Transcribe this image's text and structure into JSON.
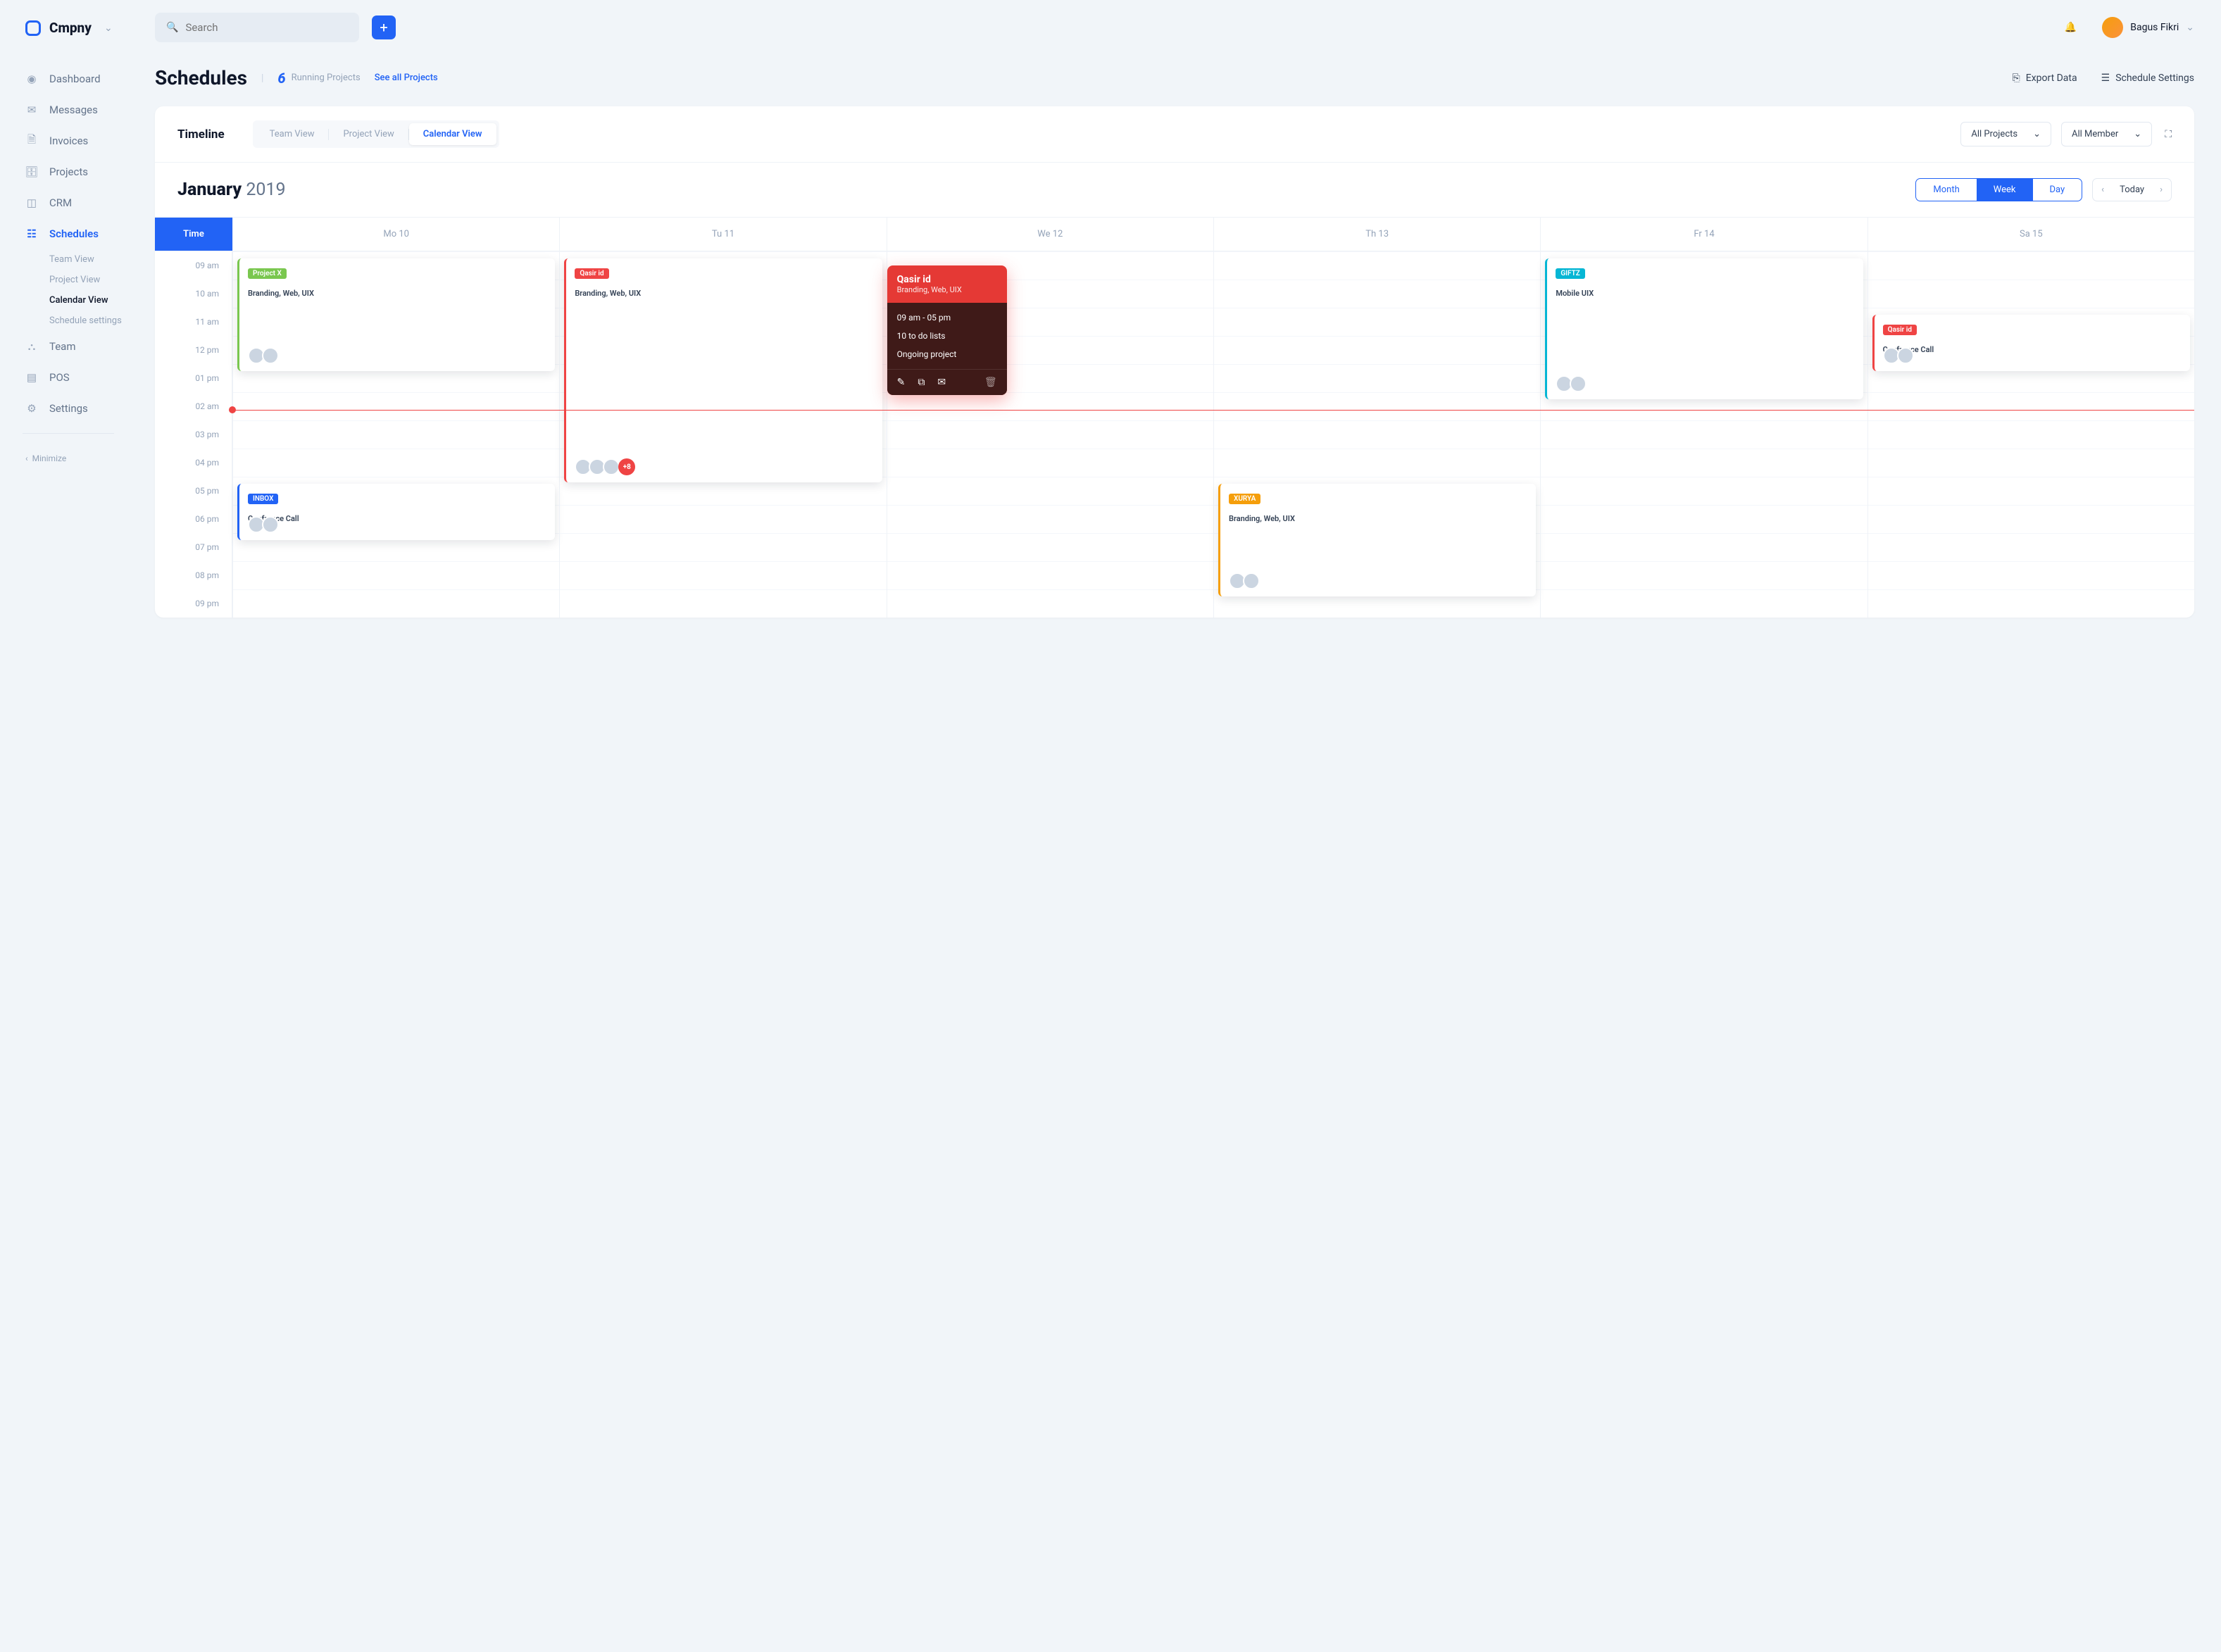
{
  "brand": "Cmpny",
  "search": {
    "placeholder": "Search"
  },
  "user": {
    "name": "Bagus Fikri"
  },
  "nav": {
    "dashboard": "Dashboard",
    "messages": "Messages",
    "invoices": "Invoices",
    "projects": "Projects",
    "crm": "CRM",
    "schedules": "Schedules",
    "team": "Team",
    "pos": "POS",
    "settings": "Settings",
    "sub": {
      "team_view": "Team View",
      "project_view": "Project View",
      "calendar_view": "Calendar View",
      "schedule_settings": "Schedule settings"
    },
    "minimize": "Minimize"
  },
  "page": {
    "title": "Schedules",
    "running_count": "6",
    "running_label": "Running Projects",
    "see_all": "See all Projects",
    "export": "Export Data",
    "settings": "Schedule Settings"
  },
  "timeline": {
    "title": "Timeline",
    "tabs": {
      "team": "Team View",
      "project": "Project View",
      "calendar": "Calendar View"
    },
    "filters": {
      "projects": "All Projects",
      "member": "All Member"
    }
  },
  "date": {
    "month": "January",
    "year": "2019"
  },
  "view": {
    "month": "Month",
    "week": "Week",
    "day": "Day",
    "today": "Today"
  },
  "cols": {
    "time": "Time",
    "d1": "Mo 10",
    "d2": "Tu 11",
    "d3": "We 12",
    "d4": "Th 13",
    "d5": "Fr 14",
    "d6": "Sa 15"
  },
  "times": [
    "09 am",
    "10 am",
    "11 am",
    "12 pm",
    "01 pm",
    "02 am",
    "03 pm",
    "04 pm",
    "05 pm",
    "06 pm",
    "07 pm",
    "08 pm",
    "09 pm"
  ],
  "cards": {
    "projectx": {
      "tag": "Project X",
      "sub": "Branding, Web, UIX"
    },
    "qasir_tu": {
      "tag": "Qasir id",
      "sub": "Branding, Web, UIX",
      "more": "+8"
    },
    "giftz": {
      "tag": "GIFTZ",
      "sub": "Mobile UIX"
    },
    "qasir_sa": {
      "tag": "Qasir id",
      "sub": "Confrence Call"
    },
    "inbox": {
      "tag": "INBOX",
      "sub": "Confrence Call"
    },
    "xurya": {
      "tag": "XURYA",
      "sub": "Branding, Web, UIX"
    }
  },
  "popover": {
    "title": "Qasir id",
    "subtitle": "Branding, Web, UIX",
    "time": "09 am - 05 pm",
    "todo": "10 to do lists",
    "status": "Ongoing project"
  },
  "colors": {
    "green": "#7ac74f",
    "red": "#ef4444",
    "cyan": "#06b6d4",
    "blue": "#2263f5",
    "orange": "#f59e0b"
  }
}
